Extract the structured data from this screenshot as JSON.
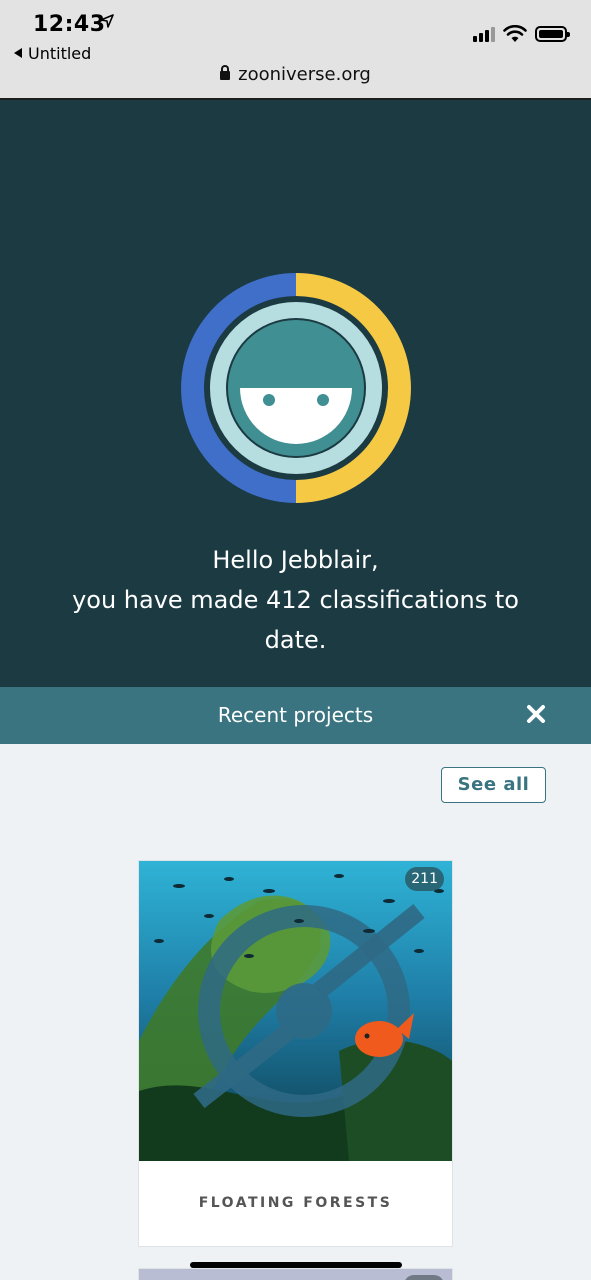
{
  "status_bar": {
    "time": "12:43",
    "back_label": "Untitled",
    "url": "zooniverse.org"
  },
  "hero": {
    "greeting_line1": "Hello Jebblair,",
    "greeting_line2": "you have made 412 classifications to date.",
    "ring_colors": {
      "left": "#3f6fc9",
      "right": "#f6c945"
    }
  },
  "recent": {
    "title": "Recent projects",
    "see_all_label": "See all"
  },
  "projects": [
    {
      "name": "FLOATING FORESTS",
      "count": "211"
    }
  ],
  "colors": {
    "hero_bg": "#1b3a42",
    "bar_bg": "#3a7480",
    "page_bg": "#eef2f5",
    "accent": "#3a7480"
  }
}
